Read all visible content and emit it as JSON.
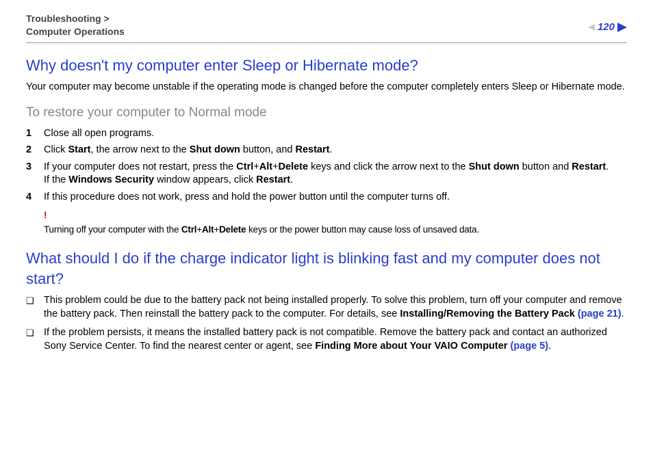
{
  "breadcrumb": {
    "line1": "Troubleshooting >",
    "line2": "Computer Operations"
  },
  "page_number": "120",
  "section1": {
    "title": "Why doesn't my computer enter Sleep or Hibernate mode?",
    "intro": "Your computer may become unstable if the operating mode is changed before the computer completely enters Sleep or Hibernate mode.",
    "subhead": "To restore your computer to Normal mode",
    "steps": {
      "n1": "1",
      "s1": "Close all open programs.",
      "n2": "2",
      "s2a": "Click ",
      "s2b": "Start",
      "s2c": ", the arrow next to the ",
      "s2d": "Shut down",
      "s2e": " button, and ",
      "s2f": "Restart",
      "s2g": ".",
      "n3": "3",
      "s3a": "If your computer does not restart, press the ",
      "s3b": "Ctrl",
      "s3p1": "+",
      "s3c": "Alt",
      "s3p2": "+",
      "s3d": "Delete",
      "s3e": " keys and click the arrow next to the ",
      "s3f": "Shut down",
      "s3g": " button and ",
      "s3h": "Restart",
      "s3i": ".",
      "s3j": "If the ",
      "s3k": "Windows Security",
      "s3l": " window appears, click ",
      "s3m": "Restart",
      "s3n": ".",
      "n4": "4",
      "s4": "If this procedure does not work, press and hold the power button until the computer turns off."
    },
    "warning": {
      "bang": "!",
      "a": "Turning off your computer with the ",
      "b": "Ctrl",
      "p1": "+",
      "c": "Alt",
      "p2": "+",
      "d": "Delete",
      "e": " keys or the power button may cause loss of unsaved data."
    }
  },
  "section2": {
    "title": "What should I do if the charge indicator light is blinking fast and my computer does not start?",
    "items": {
      "i1a": "This problem could be due to the battery pack not being installed properly. To solve this problem, turn off your computer and remove the battery pack. Then reinstall the battery pack to the computer. For details, see ",
      "i1b": "Installing/Removing the Battery Pack ",
      "i1c": "(page 21)",
      "i1d": ".",
      "i2a": "If the problem persists, it means the installed battery pack is not compatible. Remove the battery pack and contact an authorized Sony Service Center. To find the nearest center or agent, see ",
      "i2b": "Finding More about Your VAIO Computer ",
      "i2c": "(page 5)",
      "i2d": "."
    }
  }
}
